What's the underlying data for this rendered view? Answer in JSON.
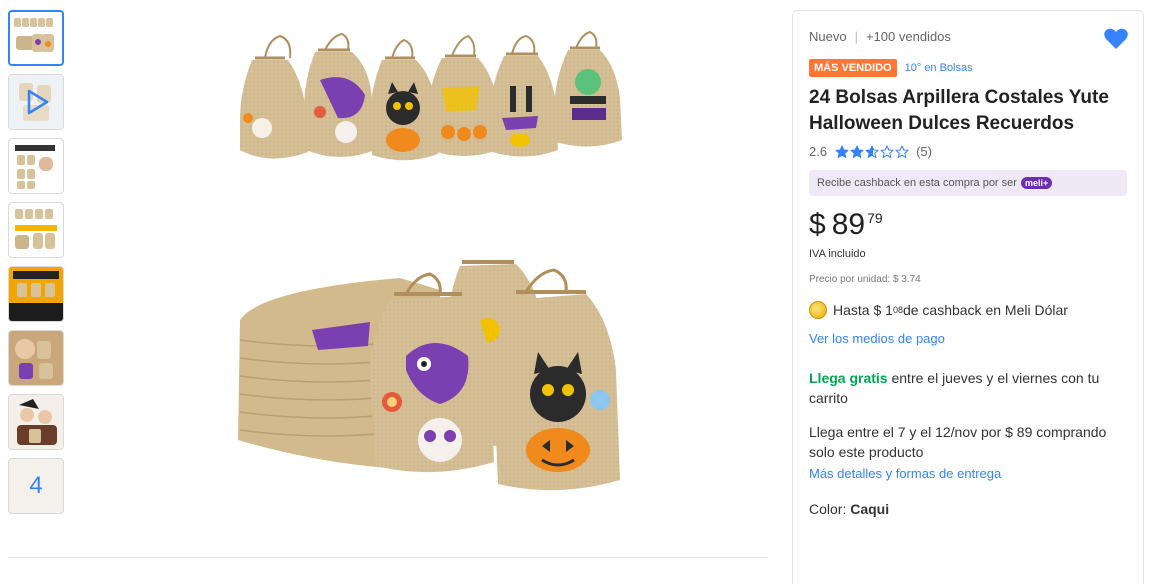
{
  "gallery": {
    "thumbnails": [
      {
        "name": "thumb-1",
        "active": true
      },
      {
        "name": "thumb-video",
        "active": false
      },
      {
        "name": "thumb-3",
        "active": false
      },
      {
        "name": "thumb-4",
        "active": false
      },
      {
        "name": "thumb-5",
        "active": false
      },
      {
        "name": "thumb-6",
        "active": false
      },
      {
        "name": "thumb-7",
        "active": false
      }
    ],
    "more_count": "4"
  },
  "product": {
    "condition": "Nuevo",
    "sold": "+100 vendidos",
    "best_seller_label": "MÁS VENDIDO",
    "rank_label": "10° en Bolsas",
    "title": "24 Bolsas Arpillera Costales Yute Halloween Dulces Recuerdos",
    "rating_value": "2.6",
    "rating_stars": 2.6,
    "review_count": "(5)",
    "cashback_banner": "Recibe cashback en esta compra por ser",
    "meli_badge": "meli+",
    "price_currency": "$",
    "price_amount": "89",
    "price_cents": "79",
    "iva_label": "IVA incluido",
    "unit_price": "Precio por unidad: $ 3.74",
    "cashback_prefix": "Hasta $ 1",
    "cashback_cents": "08",
    "cashback_suffix": " de cashback en Meli Dólar",
    "payment_link": "Ver los medios de pago",
    "shipping_free": "Llega gratis",
    "shipping_text": " entre el jueves y el viernes con tu carrito",
    "shipping_alt": "Llega entre el 7 y el 12/nov por $ 89 comprando solo este producto",
    "shipping_link": "Más detalles y formas de entrega",
    "color_label": "Color: ",
    "color_value": "Caqui"
  },
  "colors": {
    "accent": "#3483fa",
    "best_seller": "#ff7733",
    "free_shipping": "#00a650",
    "meli_purple": "#6d2eb5",
    "burlap": "#d8c29a"
  }
}
